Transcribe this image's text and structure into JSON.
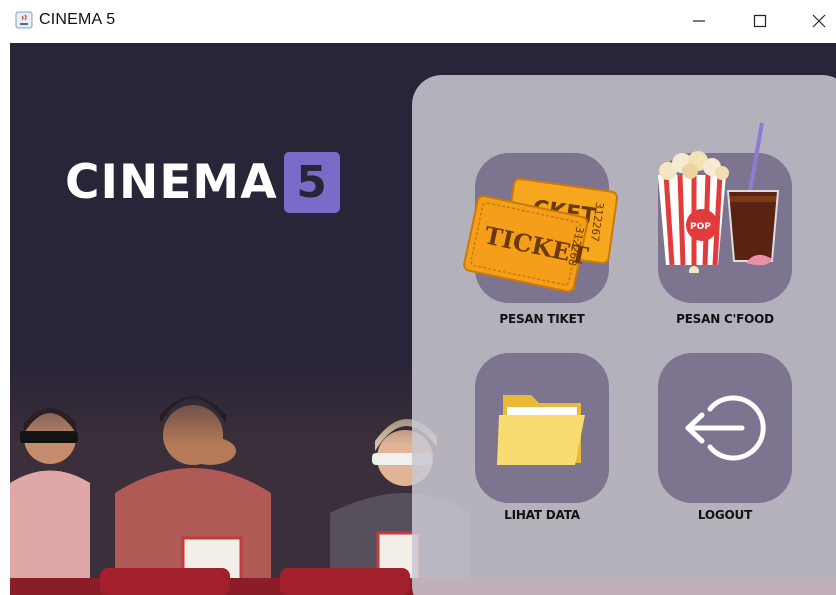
{
  "window": {
    "title": "CINEMA 5",
    "controls": {
      "minimize_icon": "minimize-icon",
      "maximize_icon": "maximize-icon",
      "close_icon": "close-icon"
    }
  },
  "logo": {
    "word": "CINEMA",
    "badge": "5",
    "badge_color": "#7b6ac8"
  },
  "menu": {
    "items": [
      {
        "label": "PESAN TIKET",
        "icon": "ticket-icon"
      },
      {
        "label": "PESAN C'FOOD",
        "icon": "popcorn-soda-icon"
      },
      {
        "label": "LIHAT DATA",
        "icon": "folder-icon"
      },
      {
        "label": "LOGOUT",
        "icon": "logout-icon"
      }
    ]
  },
  "colors": {
    "background": "#2a2438",
    "panel": "#cac8d2",
    "tile": "#7d7590"
  }
}
